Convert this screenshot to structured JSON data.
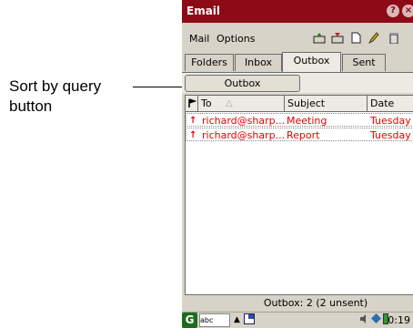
{
  "callout": {
    "text": "Sort by query button"
  },
  "window": {
    "title": "Email",
    "help_label": "?",
    "close_label": "×"
  },
  "menubar": {
    "items": [
      "Mail",
      "Options"
    ]
  },
  "tabs": [
    "Folders",
    "Inbox",
    "Outbox",
    "Sent"
  ],
  "active_tab": "Outbox",
  "sort_button": {
    "label": "Outbox"
  },
  "table": {
    "columns": [
      "To",
      "Subject",
      "Date"
    ],
    "rows": [
      {
        "to": "richard@sharp...",
        "subject": "Meeting",
        "date": "Tuesday"
      },
      {
        "to": "richard@sharp...",
        "subject": "Report",
        "date": "Tuesday"
      }
    ]
  },
  "status": {
    "text": "Outbox: 2 (2 unsent)"
  },
  "taskbar": {
    "start_label": "G",
    "abc_label": "abc",
    "clock": "0:19"
  },
  "colors": {
    "titlebar": "#8d0b16",
    "unsent_text": "#e60000",
    "panel": "#d7d3c8"
  }
}
